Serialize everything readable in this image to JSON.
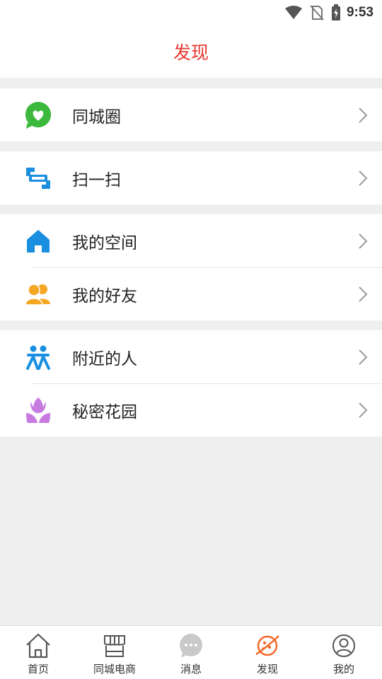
{
  "status_bar": {
    "time": "9:53"
  },
  "header": {
    "title": "发现"
  },
  "menu": {
    "groups": [
      {
        "items": [
          {
            "label": "同城圈",
            "icon": "chat-heart-icon"
          }
        ]
      },
      {
        "items": [
          {
            "label": "扫一扫",
            "icon": "scan-icon"
          }
        ]
      },
      {
        "items": [
          {
            "label": "我的空间",
            "icon": "home-icon"
          },
          {
            "label": "我的好友",
            "icon": "friends-icon"
          }
        ]
      },
      {
        "items": [
          {
            "label": "附近的人",
            "icon": "people-nearby-icon"
          },
          {
            "label": "秘密花园",
            "icon": "tulip-icon"
          }
        ]
      }
    ]
  },
  "tabbar": {
    "tabs": [
      {
        "label": "首页",
        "icon": "home-outline-icon"
      },
      {
        "label": "同城电商",
        "icon": "store-icon"
      },
      {
        "label": "消息",
        "icon": "message-icon"
      },
      {
        "label": "发现",
        "icon": "discover-icon",
        "active": true
      },
      {
        "label": "我的",
        "icon": "profile-icon"
      }
    ]
  },
  "colors": {
    "accent": "#e8372f",
    "discover_orange": "#f26a2b",
    "green": "#3cb93c",
    "blue": "#1a8fe0",
    "orange": "#f5a623",
    "purple": "#c77be0"
  }
}
